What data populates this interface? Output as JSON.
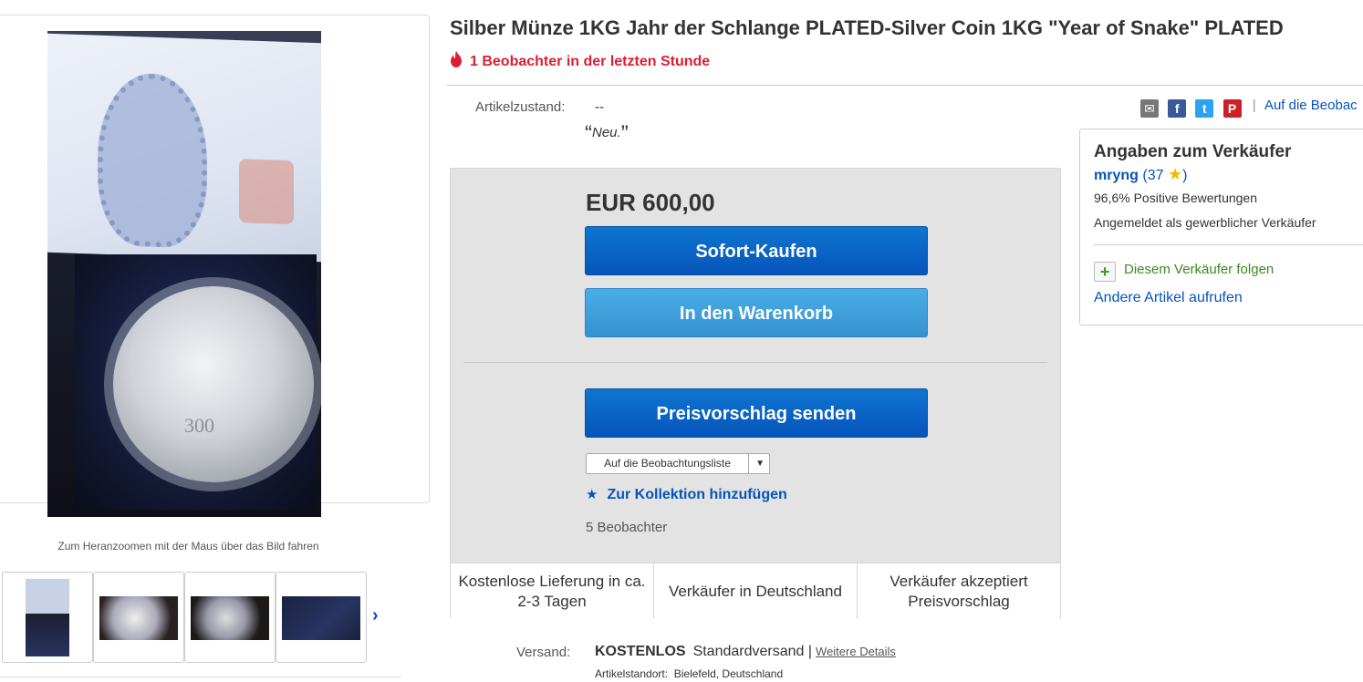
{
  "title": "Silber Münze 1KG Jahr der Schlange PLATED-Silver Coin 1KG \"Year of Snake\" PLATED",
  "hot_watchers": "1 Beobachter in der letzten Stunde",
  "condition": {
    "label": "Artikelzustand:",
    "value": "--",
    "note": "Neu."
  },
  "share": {
    "icons": [
      "mail-icon",
      "facebook-icon",
      "twitter-icon",
      "pinterest-icon"
    ],
    "watchlist_link": "Auf die Beobac"
  },
  "gallery": {
    "zoom_hint": "Zum Heranzoomen mit der Maus über das Bild fahren",
    "coin_denomination": "300"
  },
  "buy": {
    "price": "EUR 600,00",
    "buy_now": "Sofort-Kaufen",
    "add_to_cart": "In den Warenkorb",
    "make_offer": "Preisvorschlag senden",
    "watchlist_select": "Auf die Beobachtungsliste",
    "add_collection": "Zur Kollektion hinzufügen",
    "watchers": "5 Beobachter"
  },
  "features": [
    "Kostenlose Lieferung in ca. 2-3 Tagen",
    "Verkäufer in Deutschland",
    "Verkäufer akzeptiert Preisvorschlag"
  ],
  "seller": {
    "heading": "Angaben zum Verkäufer",
    "name": "mryng",
    "score": "37",
    "positive": "96,6% Positive Bewertungen",
    "business": "Angemeldet als gewerblicher Verkäufer",
    "follow": "Diesem Verkäufer folgen",
    "other_items": "Andere Artikel aufrufen"
  },
  "shipping": {
    "label": "Versand:",
    "free": "KOSTENLOS",
    "method": "Standardversand",
    "sep": "|",
    "details": "Weitere Details",
    "location_label": "Artikelstandort:",
    "location": "Bielefeld, Deutschland"
  },
  "colors": {
    "link": "#0654ba",
    "hot": "#dd1e31",
    "buy_button": "#0654ba",
    "cart_button": "#3592d0",
    "follow": "#3a8b1e"
  }
}
